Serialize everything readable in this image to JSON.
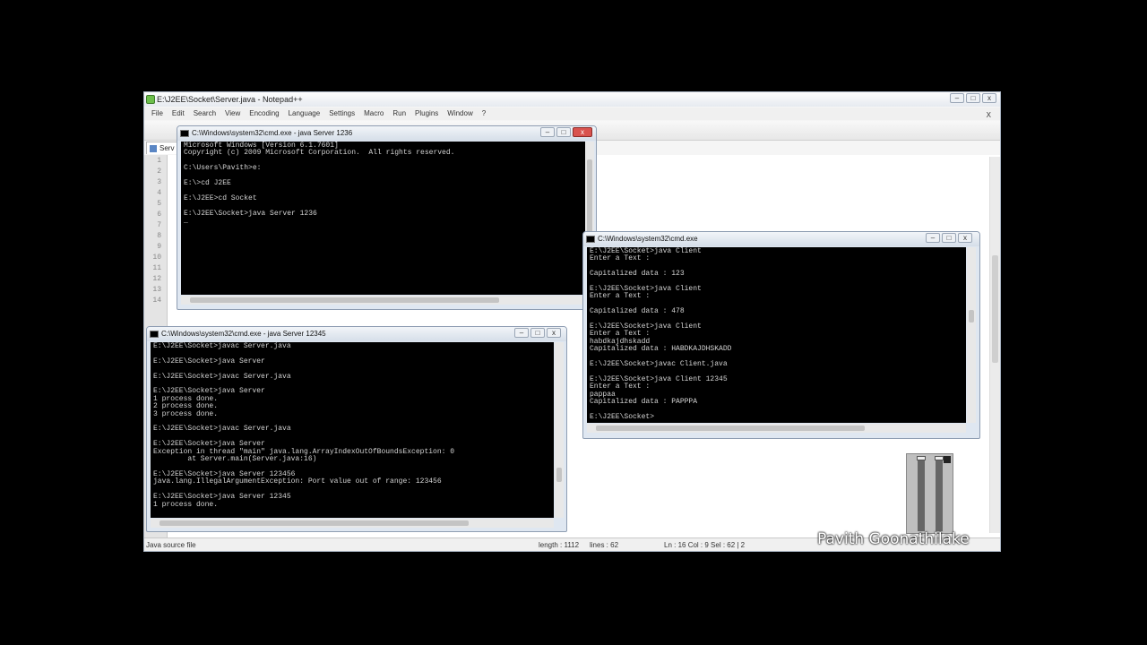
{
  "notepad": {
    "title": "E:\\J2EE\\Socket\\Server.java - Notepad++",
    "menu": [
      "File",
      "Edit",
      "Search",
      "View",
      "Encoding",
      "Language",
      "Settings",
      "Macro",
      "Run",
      "Plugins",
      "Window",
      "?"
    ],
    "menu_close": "X",
    "tab_label": "Serv",
    "line_numbers": [
      "1",
      "2",
      "3",
      "4",
      "5",
      "6",
      "7",
      "8",
      "9",
      "10",
      "11",
      "12",
      "13",
      "14"
    ],
    "status": {
      "filetype": "Java source file",
      "length": "length : 1112",
      "lines": "lines : 62",
      "position": "Ln : 16   Col : 9   Sel : 62 | 2"
    }
  },
  "cmd1": {
    "title": "C:\\Windows\\system32\\cmd.exe - java  Server 1236",
    "text": "Microsoft Windows [Version 6.1.7601]\nCopyright (c) 2009 Microsoft Corporation.  All rights reserved.\n\nC:\\Users\\Pavith>e:\n\nE:\\>cd J2EE\n\nE:\\J2EE>cd Socket\n\nE:\\J2EE\\Socket>java Server 1236\n_"
  },
  "cmd2": {
    "title": "C:\\Windows\\system32\\cmd.exe - java  Server 12345",
    "text": "E:\\J2EE\\Socket>javac Server.java\n\nE:\\J2EE\\Socket>java Server\n\nE:\\J2EE\\Socket>javac Server.java\n\nE:\\J2EE\\Socket>java Server\n1 process done.\n2 process done.\n3 process done.\n\nE:\\J2EE\\Socket>javac Server.java\n\nE:\\J2EE\\Socket>java Server\nException in thread \"main\" java.lang.ArrayIndexOutOfBoundsException: 0\n        at Server.main(Server.java:16)\n\nE:\\J2EE\\Socket>java Server 123456\njava.lang.IllegalArgumentException: Port value out of range: 123456\n\nE:\\J2EE\\Socket>java Server 12345\n1 process done."
  },
  "cmd3": {
    "title": "C:\\Windows\\system32\\cmd.exe",
    "text": "E:\\J2EE\\Socket>java Client\nEnter a Text :\n\nCapitalized data : 123\n\nE:\\J2EE\\Socket>java Client\nEnter a Text :\n\nCapitalized data : 478\n\nE:\\J2EE\\Socket>java Client\nEnter a Text :\nhabdkajdhskadd\nCapitalized data : HABDKAJDHSKADD\n\nE:\\J2EE\\Socket>javac Client.java\n\nE:\\J2EE\\Socket>java Client 12345\nEnter a Text :\npappaa\nCapitalized data : PAPPPA\n\nE:\\J2EE\\Socket>"
  },
  "window_buttons": {
    "minimize": "–",
    "maximize": "□",
    "close": "x"
  },
  "watermark": "Pavith Goonathilake"
}
